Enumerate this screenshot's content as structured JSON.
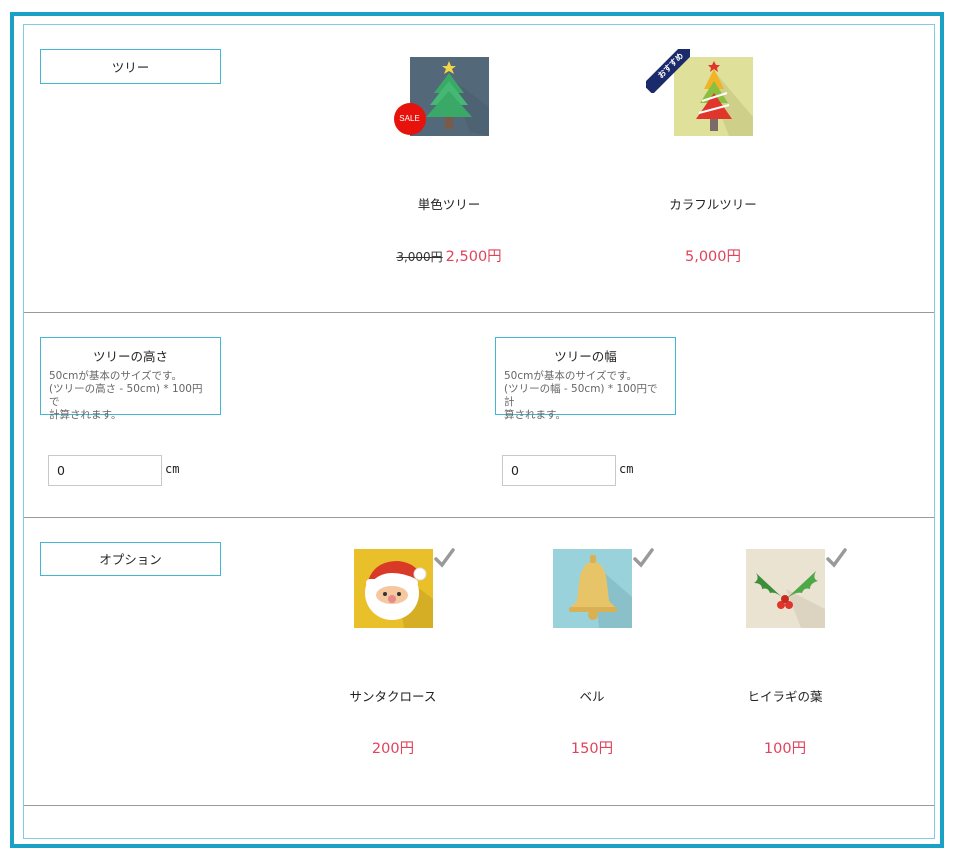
{
  "sections": {
    "tree": {
      "label": "ツリー"
    },
    "height": {
      "title": "ツリーの高さ",
      "desc_lines": [
        "50cmが基本のサイズです。",
        "(ツリーの高さ - 50cm) * 100円で",
        "計算されます。"
      ],
      "value": "0",
      "unit": "cm"
    },
    "width": {
      "title": "ツリーの幅",
      "desc_lines": [
        "50cmが基本のサイズです。",
        "(ツリーの幅 - 50cm) * 100円で計",
        "算されます。"
      ],
      "value": "0",
      "unit": "cm"
    },
    "option": {
      "label": "オプション"
    }
  },
  "products": [
    {
      "name": "単色ツリー",
      "old_price": "3,000円",
      "price": "2,500円",
      "badge": "SALE",
      "icon": "green-tree-icon"
    },
    {
      "name": "カラフルツリー",
      "price": "5,000円",
      "badge": "おすすめ",
      "icon": "colorful-tree-icon"
    }
  ],
  "options": [
    {
      "name": "サンタクロース",
      "price": "200円",
      "icon": "santa-icon",
      "checked": true
    },
    {
      "name": "ベル",
      "price": "150円",
      "icon": "bell-icon",
      "checked": true
    },
    {
      "name": "ヒイラギの葉",
      "price": "100円",
      "icon": "holly-icon",
      "checked": true
    }
  ],
  "colors": {
    "accent": "#1aa1c6",
    "price": "#e0435c",
    "sale": "#e8120c",
    "ribbon": "#1b2a6b"
  }
}
